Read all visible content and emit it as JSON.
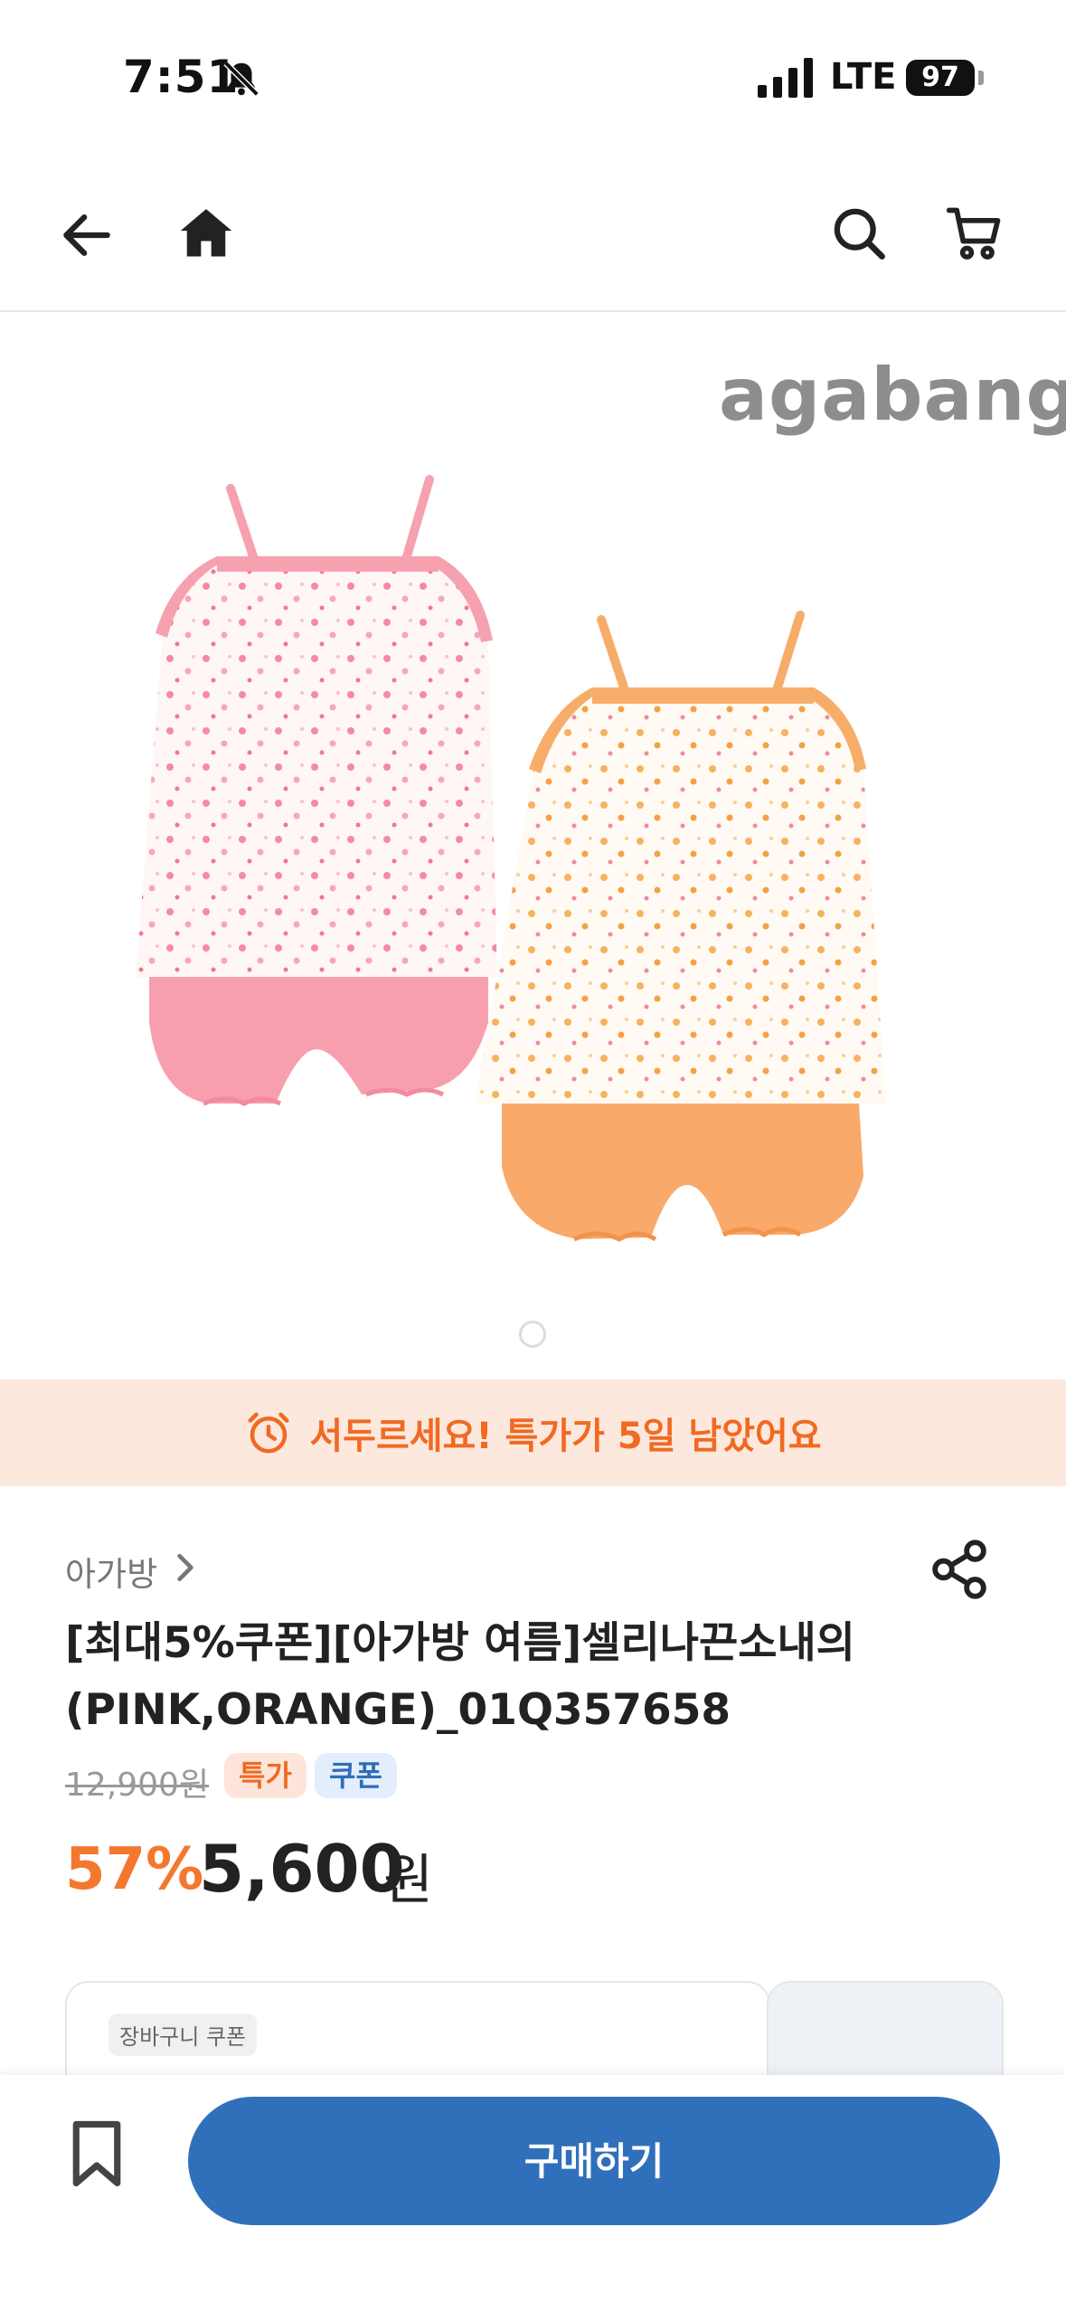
{
  "status_bar": {
    "time": "7:51",
    "network": "LTE",
    "battery": "97"
  },
  "nav": {
    "back_icon": "arrow-left-icon",
    "home_icon": "home-icon",
    "search_icon": "search-icon",
    "cart_icon": "cart-icon"
  },
  "product": {
    "brand_logo": "agabang",
    "image_pager": {
      "current": 1,
      "total": 1
    },
    "banner_text": "서두르세요! 특가가 5일 남았어요",
    "brand_link": "아가방",
    "title": "[최대5%쿠폰][아가방 여름]셀리나끈소내의(PINK,ORANGE)_01Q357658",
    "original_price": "12,900원",
    "badges": [
      "특가",
      "쿠폰"
    ],
    "discount": "57%",
    "price": "5,600",
    "currency": "원"
  },
  "coupon": {
    "tag": "장바구니 쿠폰"
  },
  "bottom_bar": {
    "buy_label": "구매하기"
  },
  "colors": {
    "accent_orange": "#f06a22",
    "buy_blue": "#3070bb",
    "banner_bg": "#fde8de"
  }
}
